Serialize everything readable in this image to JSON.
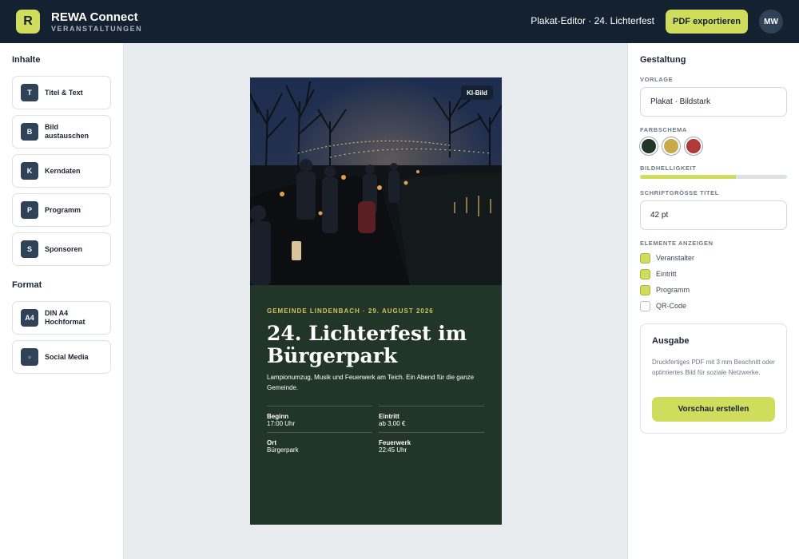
{
  "app": {
    "logo_letter": "R",
    "name": "REWA Connect",
    "subtitle": "VERANSTALTUNGEN",
    "context": "Plakat-Editor · 24. Lichterfest",
    "export_label": "PDF exportieren",
    "user_initials": "MW"
  },
  "sidebar": {
    "content_title": "Inhalte",
    "content_items": [
      {
        "badge": "T",
        "label": "Titel & Text"
      },
      {
        "badge": "B",
        "label": "Bild austauschen"
      },
      {
        "badge": "K",
        "label": "Kerndaten"
      },
      {
        "badge": "P",
        "label": "Programm"
      },
      {
        "badge": "S",
        "label": "Sponsoren"
      }
    ],
    "format_title": "Format",
    "format_items": [
      {
        "badge": "A4",
        "label": "DIN A4 Hochformat"
      },
      {
        "badge": "▫",
        "label": "Social Media"
      }
    ]
  },
  "poster": {
    "ai_badge": "KI-Bild",
    "kicker": "GEMEINDE LINDENBACH · 29. AUGUST 2026",
    "title": "24. Lichterfest im Bürgerpark",
    "description": "Lampionumzug, Musik und Feuerwerk am Teich. Ein Abend für die ganze Gemeinde.",
    "facts": [
      {
        "label": "Beginn",
        "value": "17:00 Uhr"
      },
      {
        "label": "Eintritt",
        "value": "ab 3,00 €"
      },
      {
        "label": "Ort",
        "value": "Bürgerpark"
      },
      {
        "label": "Feuerwerk",
        "value": "22:45 Uhr"
      }
    ]
  },
  "design": {
    "title": "Gestaltung",
    "template_label": "VORLAGE",
    "template_value": "Plakat · Bildstark",
    "color_label": "FARBSCHEMA",
    "colors": [
      "#213528",
      "#c9a94a",
      "#b0393a"
    ],
    "brightness_label": "BILDHELLIGKEIT",
    "brightness_fraction": 0.65,
    "fontsize_label": "SCHRIFTGRÖSSE TITEL",
    "fontsize_value": "42 pt",
    "elements_label": "ELEMENTE ANZEIGEN",
    "elements": [
      {
        "label": "Veranstalter",
        "checked": true
      },
      {
        "label": "Eintritt",
        "checked": true
      },
      {
        "label": "Programm",
        "checked": true
      },
      {
        "label": "QR-Code",
        "checked": false
      }
    ]
  },
  "output": {
    "title": "Ausgabe",
    "text": "Druckfertiges PDF mit 3 mm Beschnitt oder optimiertes Bild für soziale Netzwerke.",
    "button": "Vorschau erstellen"
  },
  "colors": {
    "topbar": "#142130",
    "accent": "#cfdc5c",
    "poster_bg": "#213528",
    "kicker": "#cfc25c"
  }
}
